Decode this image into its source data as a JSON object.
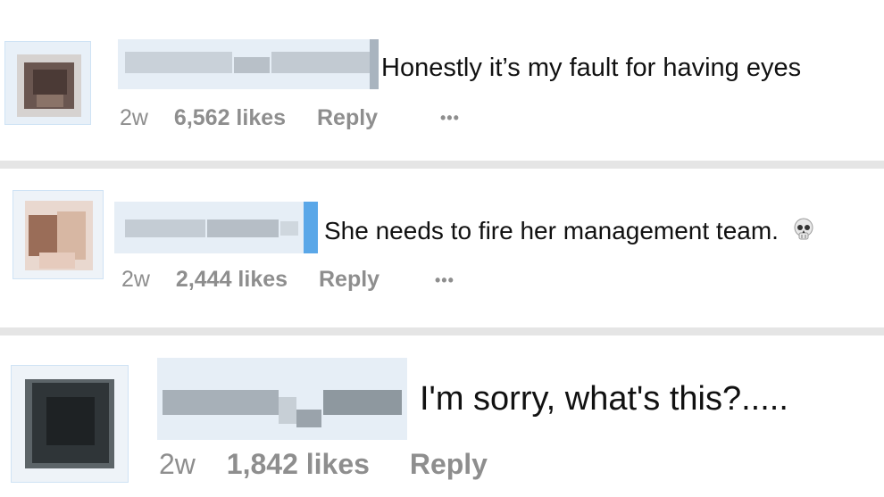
{
  "comments": [
    {
      "text": "Honestly it’s my fault for having eyes",
      "age": "2w",
      "likes": "6,562 likes",
      "reply": "Reply",
      "more": "•••"
    },
    {
      "text": "She needs to fire her management team.",
      "emoji": "skull-emoji",
      "age": "2w",
      "likes": "2,444 likes",
      "reply": "Reply",
      "more": "•••"
    },
    {
      "text": "I'm sorry, what's this?.....",
      "age": "2w",
      "likes": "1,842 likes",
      "reply": "Reply"
    }
  ]
}
